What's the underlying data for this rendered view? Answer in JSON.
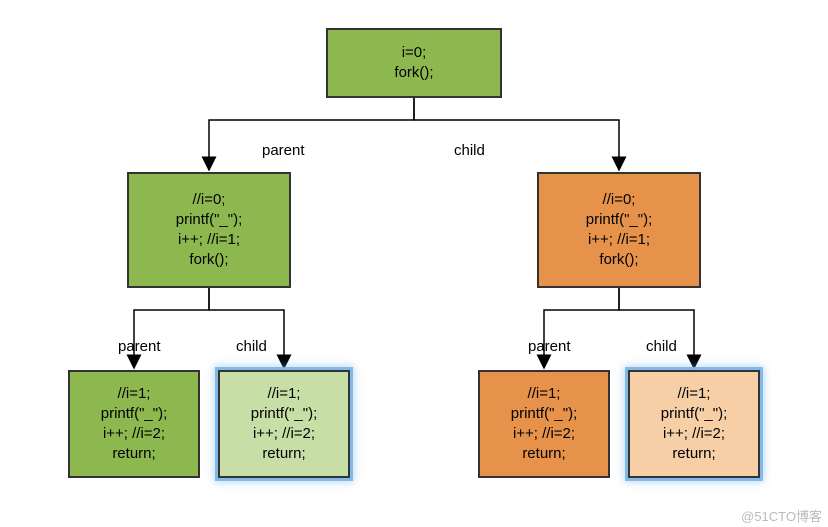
{
  "diagram": {
    "root": {
      "text": "i=0;\nfork();"
    },
    "edge_root_left": "parent",
    "edge_root_right": "child",
    "left_mid": {
      "text": "//i=0;\nprintf(\"_\");\ni++; //i=1;\nfork();"
    },
    "right_mid": {
      "text": "//i=0;\nprintf(\"_\");\ni++; //i=1;\nfork();"
    },
    "edge_mid_left_l": "parent",
    "edge_mid_left_r": "child",
    "edge_mid_right_l": "parent",
    "edge_mid_right_r": "child",
    "leaf_ll": {
      "text": "//i=1;\nprintf(\"_\");\ni++; //i=2;\nreturn;"
    },
    "leaf_lr": {
      "text": "//i=1;\nprintf(\"_\");\ni++; //i=2;\nreturn;"
    },
    "leaf_rl": {
      "text": "//i=1;\nprintf(\"_\");\ni++; //i=2;\nreturn;"
    },
    "leaf_rr": {
      "text": "//i=1;\nprintf(\"_\");\ni++; //i=2;\nreturn;"
    }
  },
  "colors": {
    "green_dark": "#8db84f",
    "green_light": "#c7dfa7",
    "orange_dark": "#e6924a",
    "orange_light": "#f6cfa6"
  },
  "watermark": "@51CTO博客"
}
